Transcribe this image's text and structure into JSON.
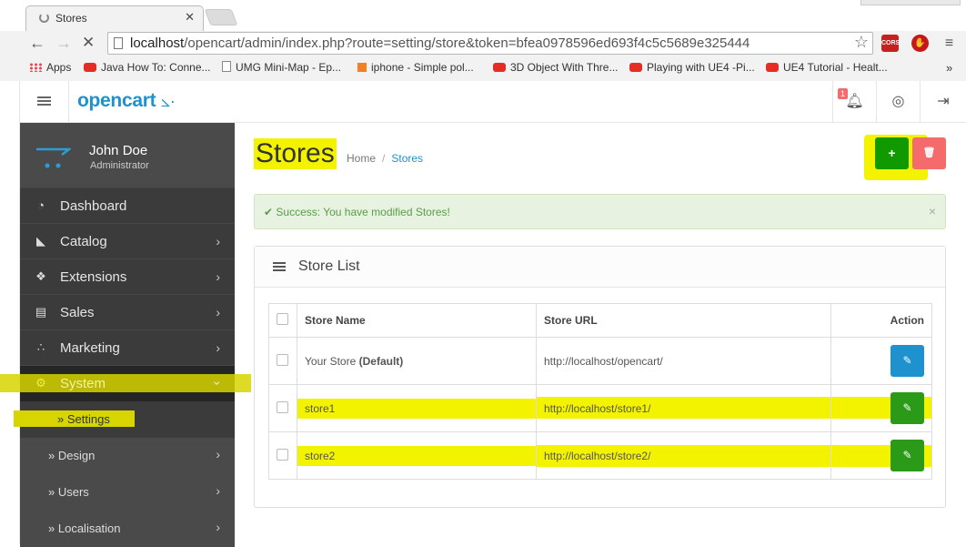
{
  "browser": {
    "tab_title": "Stores",
    "close_glyph": "✕",
    "url_host": "localhost",
    "url_path": "/opencart/admin/index.php?route=setting/store&token=bfea0978596ed693f4c5c5689e325444",
    "ext_cors": "CORS",
    "bookmarks": [
      {
        "label": "Apps",
        "icon": "apps-icon"
      },
      {
        "label": "Java How To: Conne...",
        "icon": "youtube-icon"
      },
      {
        "label": "UMG Mini-Map - Ep...",
        "icon": "page-icon"
      },
      {
        "label": "iphone - Simple pol...",
        "icon": "stackoverflow-icon"
      },
      {
        "label": "3D Object With Thre...",
        "icon": "youtube-icon"
      },
      {
        "label": "Playing with UE4 -Pi...",
        "icon": "youtube-icon"
      },
      {
        "label": "UE4 Tutorial - Healt...",
        "icon": "youtube-icon"
      }
    ],
    "more": "»"
  },
  "header": {
    "logo": "opencart",
    "notification_count": "1"
  },
  "user": {
    "name": "John Doe",
    "role": "Administrator"
  },
  "menu": [
    {
      "label": "Dashboard",
      "icon": "dashboard-icon"
    },
    {
      "label": "Catalog",
      "icon": "tags-icon"
    },
    {
      "label": "Extensions",
      "icon": "puzzle-icon"
    },
    {
      "label": "Sales",
      "icon": "cart-icon"
    },
    {
      "label": "Marketing",
      "icon": "share-icon"
    },
    {
      "label": "System",
      "icon": "cog-icon"
    }
  ],
  "submenu": [
    "Settings",
    "Design",
    "Users",
    "Localisation"
  ],
  "page": {
    "title": "Stores",
    "breadcrumb": [
      "Home",
      "Stores"
    ]
  },
  "alert": {
    "text": "Success: You have modified Stores!"
  },
  "panel": {
    "title": "Store List",
    "columns": [
      "Store Name",
      "Store URL",
      "Action"
    ],
    "rows": [
      {
        "name": "Your Store",
        "suffix": "(Default)",
        "url": "http://localhost/opencart/"
      },
      {
        "name": "store1",
        "suffix": "",
        "url": "http://localhost/store1/"
      },
      {
        "name": "store2",
        "suffix": "",
        "url": "http://localhost/store2/"
      }
    ]
  },
  "colors": {
    "primary": "#1e91cf",
    "danger": "#f56b6b",
    "sidebar": "#515151",
    "highlight": "#f3f300",
    "add_button": "#109a00"
  }
}
